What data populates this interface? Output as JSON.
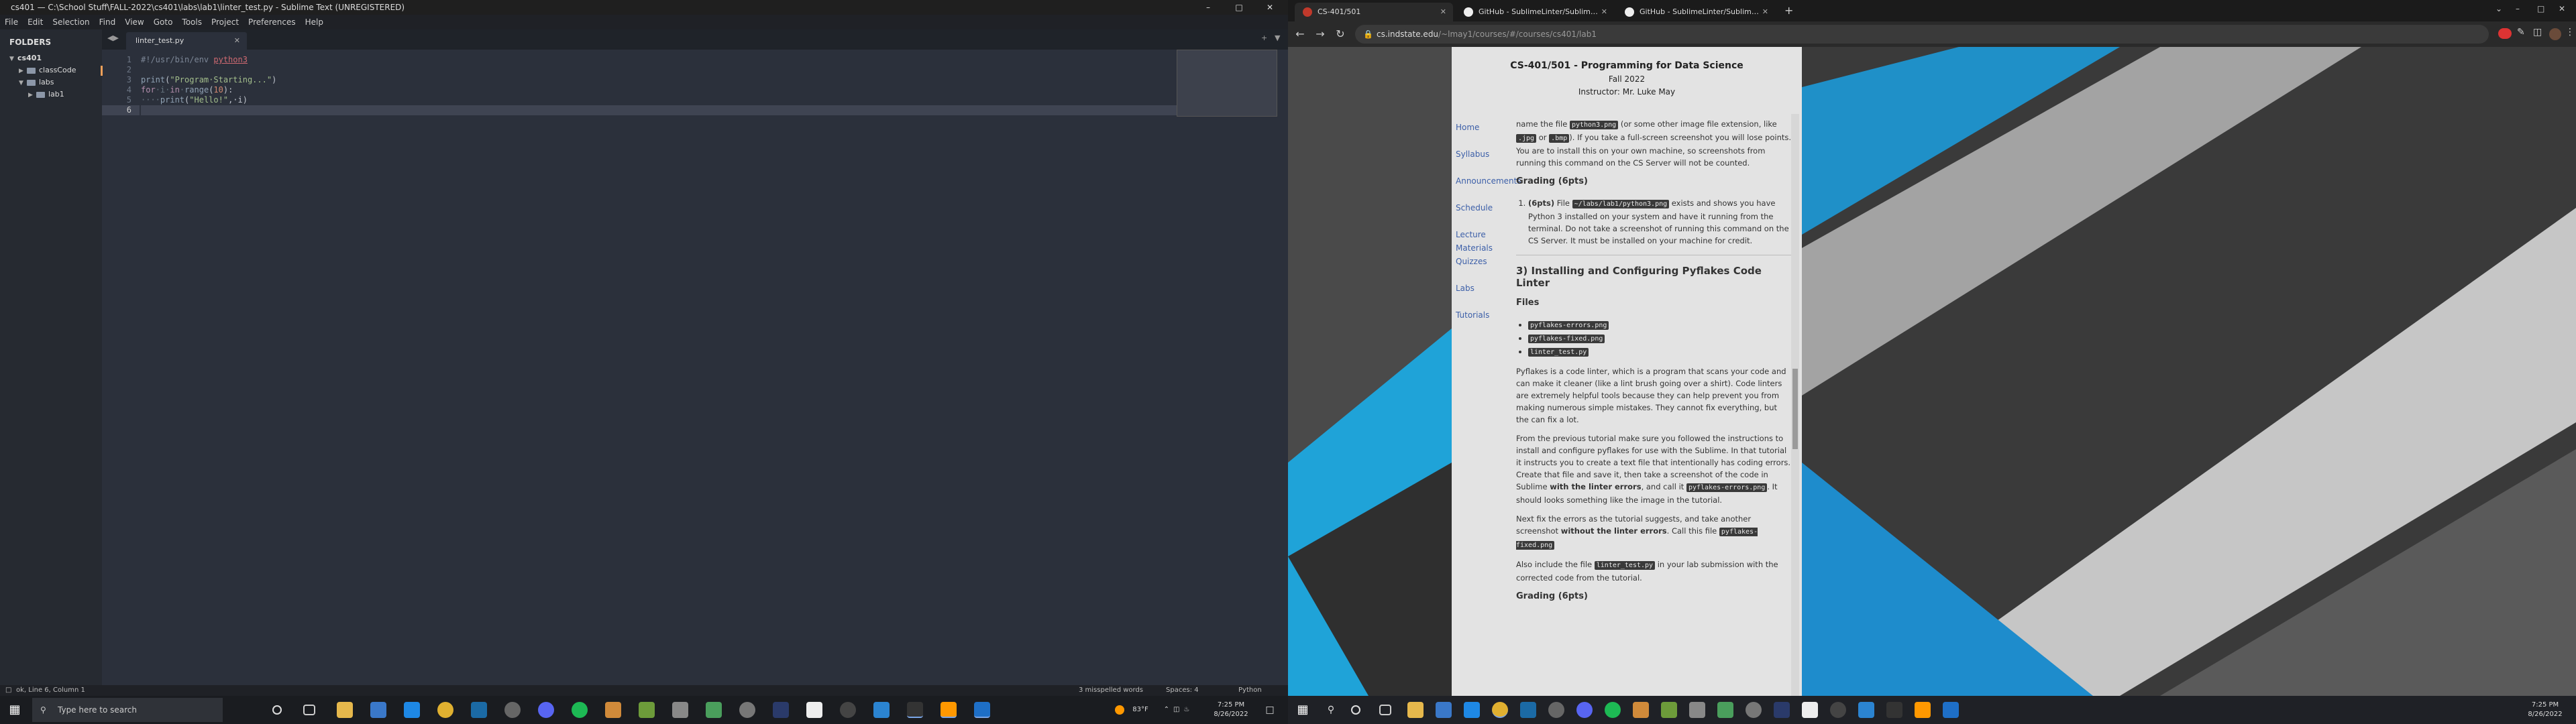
{
  "sublime": {
    "title": "cs401 — C:\\School Stuff\\FALL-2022\\cs401\\labs\\lab1\\linter_test.py - Sublime Text (UNREGISTERED)",
    "menu": [
      "File",
      "Edit",
      "Selection",
      "Find",
      "View",
      "Goto",
      "Tools",
      "Project",
      "Preferences",
      "Help"
    ],
    "folders_header": "FOLDERS",
    "tree": [
      "cs401",
      "classCode",
      "labs",
      "lab1"
    ],
    "tab": "linter_test.py",
    "lines": [
      "1",
      "2",
      "3",
      "4",
      "5",
      "6"
    ],
    "code": {
      "l1a": "#!/usr/bin/env ",
      "l1b": "python3",
      "l3a": "print",
      "l3b": "(",
      "l3c": "\"Program·Starting...\"",
      "l3d": ")",
      "l4a": "for",
      "l4b": "·i·",
      "l4c": "in",
      "l4d": "·",
      "l4e": "range",
      "l4f": "(",
      "l4g": "10",
      "l4h": "):",
      "l5a": "····",
      "l5b": "print",
      "l5c": "(",
      "l5d": "\"Hello!\"",
      "l5e": ",·i)"
    },
    "status_left": "ok, Line 6, Column 1",
    "status_misspelled": "3 misspelled words",
    "status_spaces": "Spaces: 4",
    "status_syntax": "Python"
  },
  "taskbar_left": {
    "search_placeholder": "Type here to search",
    "temp": "83°F",
    "time": "7:25 PM",
    "date": "8/26/2022"
  },
  "chrome": {
    "tabs": [
      "CS-401/501",
      "GitHub - SublimeLinter/Sublim…",
      "GitHub - SublimeLinter/Sublim…"
    ],
    "url_host": "cs.indstate.edu",
    "url_path": "/~lmay1/courses/#/courses/cs401/lab1"
  },
  "course": {
    "title": "CS-401/501 - Programming for Data Science",
    "term": "Fall 2022",
    "instructor": "Instructor: Mr. Luke May",
    "nav": [
      "Home",
      "Syllabus",
      "Announcements",
      "Schedule",
      "Lecture Materials",
      "Quizzes",
      "Labs",
      "Tutorials"
    ],
    "p0a": "name the file ",
    "p0code": "python3.png",
    "p0b": " (or some other image file extension, like ",
    "p0c1": ".jpg",
    "p0or": " or ",
    "p0c2": ".bmp",
    "p0d": "). If you take a full-screen screenshot you will lose points. You are to install this on your own machine, so screenshots from running this command on the CS Server will not be counted.",
    "grading1": "Grading (6pts)",
    "g1pts": "(6pts)",
    "g1a": " File ",
    "g1code": "~/labs/lab1/python3.png",
    "g1b": " exists and shows you have Python 3 installed on your system and have it running from the terminal. Do not take a screenshot of running this command on the CS Server. It must be installed on your machine for credit.",
    "section3": "3) Installing and Configuring Pyflakes Code Linter",
    "files_heading": "Files",
    "files": [
      "pyflakes-errors.png",
      "pyflakes-fixed.png",
      "linter_test.py"
    ],
    "p1": "Pyflakes is a code linter, which is a program that scans your code and can make it cleaner (like a lint brush going over a shirt). Code linters are extremely helpful tools because they can help prevent you from making numerous simple mistakes. They cannot fix everything, but the can fix a lot.",
    "p2a": "From the previous tutorial make sure you followed the instructions to install and configure pyflakes for use with the Sublime. In that tutorial it instructs you to create a text file that intentionally has coding errors. Create that file and save it, then take a screenshot of the code in Sublime ",
    "p2b": "with the linter errors",
    "p2c": ", and call it ",
    "p2code": "pyflakes-errors.png",
    "p2d": ". It should looks something like the image in the tutorial.",
    "p3a": "Next fix the errors as the tutorial suggests, and take another screenshot ",
    "p3b": "without the linter errors",
    "p3c": ". Call this file ",
    "p3code": "pyflakes-fixed.png",
    "p4a": "Also include the file ",
    "p4code": "linter_test.py",
    "p4b": " in your lab submission with the corrected code from the tutorial.",
    "grading2": "Grading (6pts)"
  },
  "taskbar_right": {
    "time": "7:25 PM",
    "date": "8/26/2022"
  }
}
